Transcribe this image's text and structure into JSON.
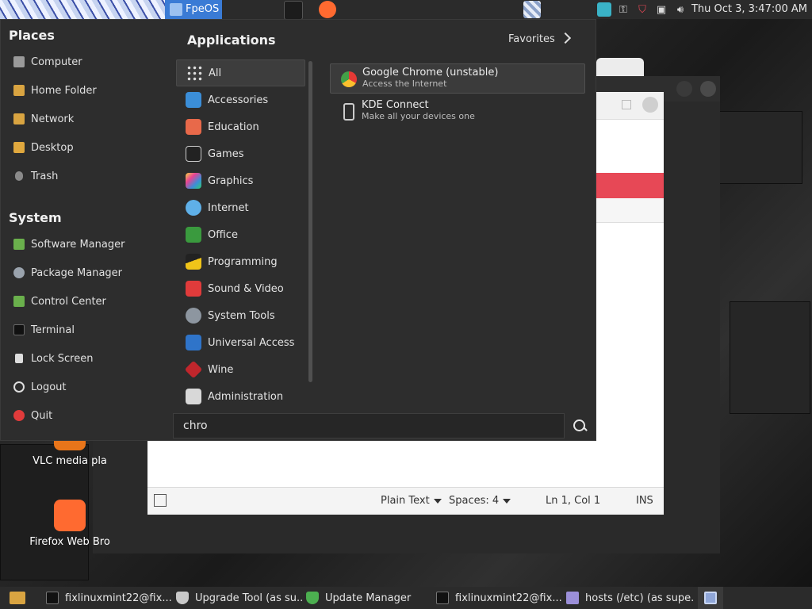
{
  "top_panel": {
    "workspace_label": "FpeOS",
    "clock": "Thu Oct  3,  3:47:00 AM",
    "tray_icons": [
      "keepassxc-icon",
      "key-icon",
      "shield-icon",
      "window-icon",
      "volume-icon"
    ]
  },
  "menu": {
    "places_title": "Places",
    "places": [
      "Computer",
      "Home Folder",
      "Network",
      "Desktop",
      "Trash"
    ],
    "system_title": "System",
    "system": [
      "Software Manager",
      "Package Manager",
      "Control Center",
      "Terminal",
      "Lock Screen",
      "Logout",
      "Quit"
    ],
    "applications_title": "Applications",
    "favorites_label": "Favorites",
    "categories": [
      "All",
      "Accessories",
      "Education",
      "Games",
      "Graphics",
      "Internet",
      "Office",
      "Programming",
      "Sound & Video",
      "System Tools",
      "Universal Access",
      "Wine",
      "Administration"
    ],
    "results": [
      {
        "name": "Google Chrome (unstable)",
        "desc": "Access the Internet"
      },
      {
        "name": "KDE Connect",
        "desc": "Make all your devices one"
      }
    ],
    "search_value": "chro"
  },
  "editor_status": {
    "syntax": "Plain Text",
    "spaces": "Spaces: 4",
    "position": "Ln 1, Col 1",
    "mode": "INS"
  },
  "desktop_icons": [
    "VLC media pla",
    "Firefox Web Bro"
  ],
  "taskbar": [
    "fixlinuxmint22@fix...",
    "Upgrade Tool (as su...",
    "Update Manager",
    "fixlinuxmint22@fix...",
    "hosts (/etc) (as supe..."
  ],
  "colors": {
    "accent_blue": "#3a7bd5",
    "update_red": "#e74856",
    "firefox_orange": "#ff6a30"
  }
}
